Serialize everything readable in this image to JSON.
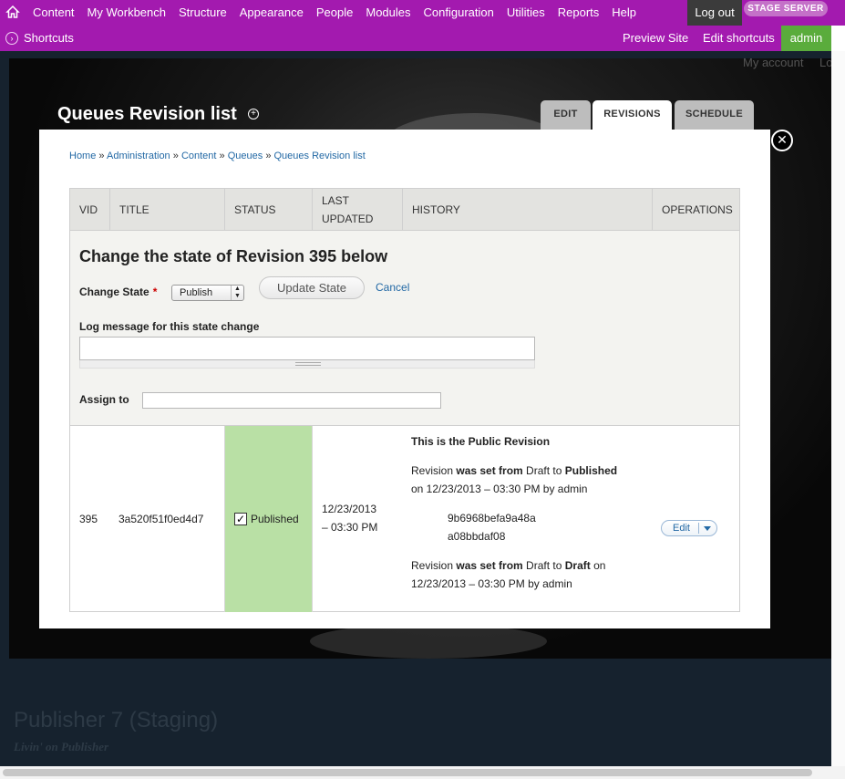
{
  "toolbar": {
    "menu": [
      "Content",
      "My Workbench",
      "Structure",
      "Appearance",
      "People",
      "Modules",
      "Configuration",
      "Utilities",
      "Reports",
      "Help"
    ],
    "logout": "Log out",
    "stage_badge": "STAGE SERVER",
    "home_icon": "home-icon"
  },
  "shortcuts": {
    "label": "Shortcuts",
    "preview_site": "Preview Site",
    "edit_shortcuts": "Edit shortcuts",
    "user": "admin"
  },
  "page": {
    "my_account": "My account",
    "logout_cut": "Lo",
    "title": "Queues Revision list",
    "tabs": [
      "EDIT",
      "REVISIONS",
      "SCHEDULE"
    ],
    "active_tab": "REVISIONS",
    "site_name": "Publisher 7 (Staging)",
    "slogan": "Livin' on Publisher"
  },
  "modal": {
    "close_glyph": "✕",
    "breadcrumb": [
      "Home",
      "Administration",
      "Content",
      "Queues",
      "Queues Revision list"
    ],
    "breadcrumb_sep": "»",
    "columns": [
      "VID",
      "TITLE",
      "STATUS",
      "LAST UPDATED",
      "HISTORY",
      "OPERATIONS"
    ],
    "form": {
      "title": "Change the state of Revision 395 below",
      "change_state_label": "Change State",
      "required_mark": "*",
      "state_value": "Publish",
      "update_button": "Update State",
      "cancel": "Cancel",
      "log_label": "Log message for this state change",
      "log_value": "",
      "assign_label": "Assign to",
      "assign_value": ""
    },
    "row": {
      "vid": "395",
      "title": "3a520f51f0ed4d7",
      "status": "Published",
      "updated_line1": "12/23/2013",
      "updated_line2": "– 03:30 PM",
      "history": {
        "public": "This is the Public Revision",
        "e1_a": "Revision ",
        "e1_b": "was set from",
        "e1_c": " Draft to ",
        "e1_d": "Published",
        "e1_line2": "on 12/23/2013 – 03:30 PM by admin",
        "hash1": "9b6968befa9a48a",
        "hash2": "a08bbdaf08",
        "e2_a": "Revision ",
        "e2_b": "was set from",
        "e2_c": " Draft to ",
        "e2_d": "Draft",
        "e2_e": " on",
        "e2_line2": "12/23/2013 – 03:30 PM by admin"
      },
      "operation": "Edit"
    }
  },
  "colors": {
    "toolbar": "#a31aaf",
    "admin": "#5aac3c",
    "status_published": "#b9e0a5",
    "link": "#2369a5"
  }
}
